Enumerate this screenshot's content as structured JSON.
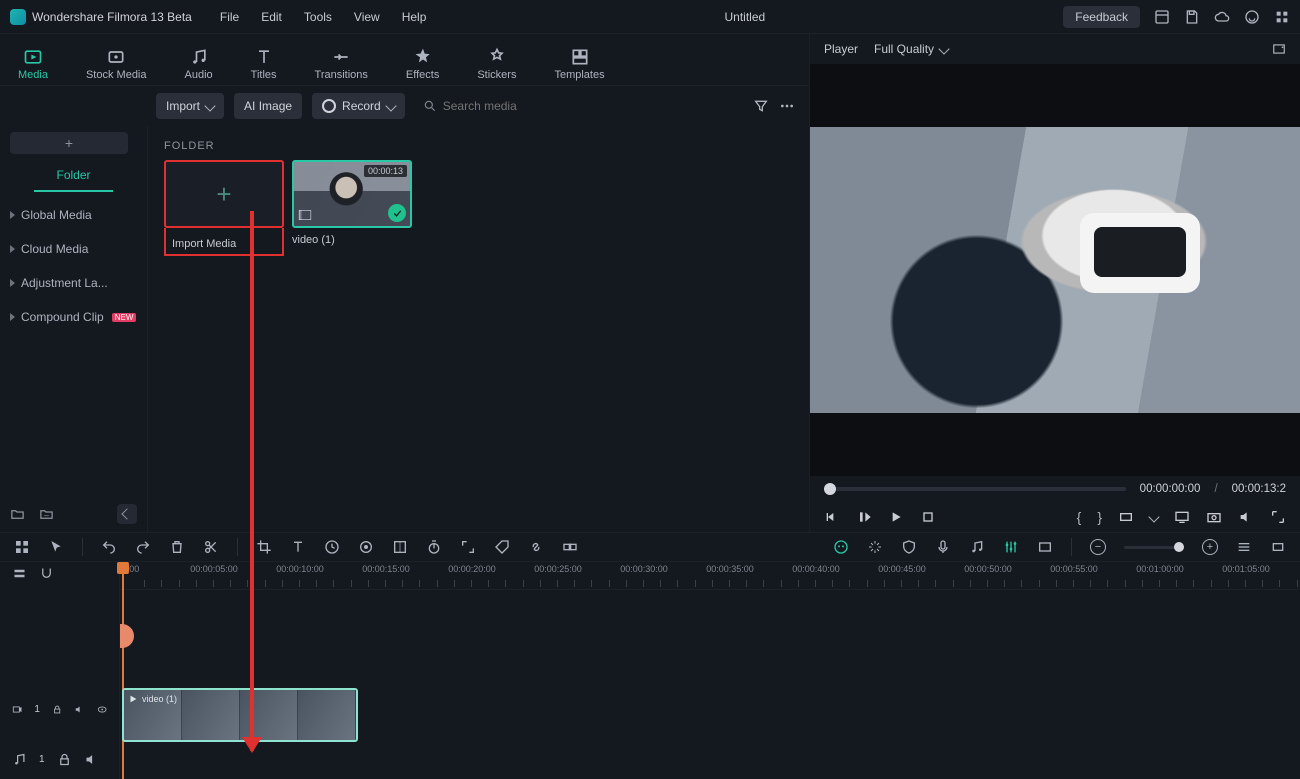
{
  "app": {
    "title": "Wondershare Filmora 13 Beta",
    "doc_title": "Untitled",
    "feedback": "Feedback"
  },
  "menu": {
    "file": "File",
    "edit": "Edit",
    "tools": "Tools",
    "view": "View",
    "help": "Help"
  },
  "categories": {
    "media": "Media",
    "stock": "Stock Media",
    "audio": "Audio",
    "titles": "Titles",
    "transitions": "Transitions",
    "effects": "Effects",
    "stickers": "Stickers",
    "templates": "Templates"
  },
  "actionbar": {
    "import": "Import",
    "ai_image": "AI Image",
    "record": "Record",
    "search_placeholder": "Search media"
  },
  "sidebar": {
    "folder_tab": "Folder",
    "items": [
      {
        "label": "Global Media"
      },
      {
        "label": "Cloud Media"
      },
      {
        "label": "Adjustment La..."
      },
      {
        "label": "Compound Clip",
        "badge": "NEW"
      }
    ]
  },
  "browser": {
    "folder_heading": "FOLDER",
    "import_media": "Import Media",
    "clip1_name": "video (1)",
    "clip1_duration": "00:00:13"
  },
  "player": {
    "tab": "Player",
    "quality": "Full Quality",
    "current": "00:00:00:00",
    "separator": "/",
    "total": "00:00:13:2"
  },
  "ruler_labels": [
    "00:00",
    "00:00:05:00",
    "00:00:10:00",
    "00:00:15:00",
    "00:00:20:00",
    "00:00:25:00",
    "00:00:30:00",
    "00:00:35:00",
    "00:00:40:00",
    "00:00:45:00",
    "00:00:50:00",
    "00:00:55:00",
    "00:01:00:00",
    "00:01:05:00"
  ],
  "timeline": {
    "clip_label": "video (1)"
  },
  "track_labels": {
    "video": "1",
    "audio": "1"
  }
}
